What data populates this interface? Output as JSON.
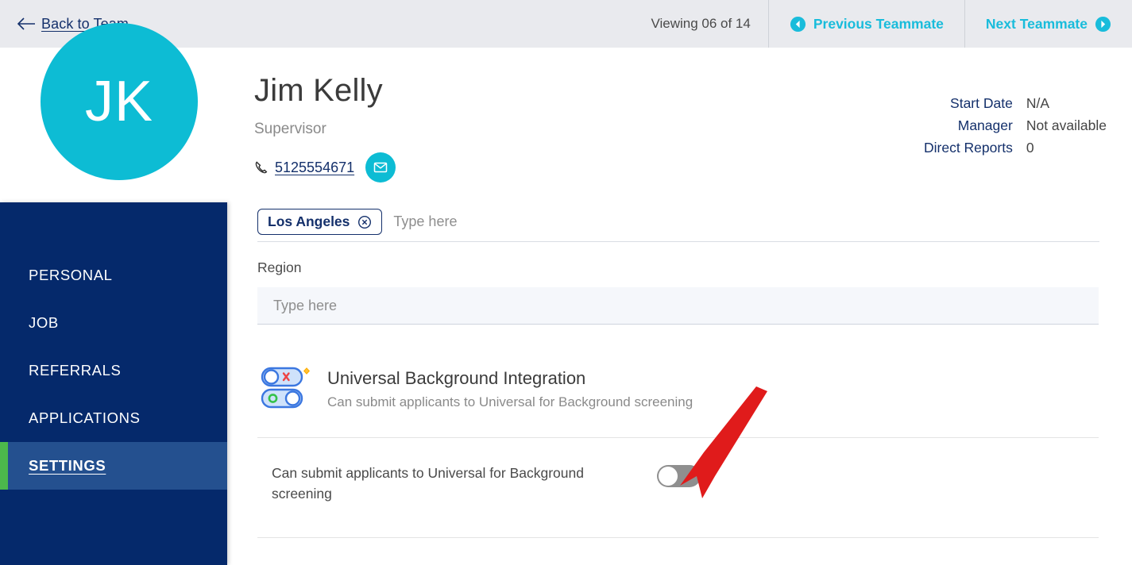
{
  "topbar": {
    "back_label": "Back to Team",
    "back_icon": "arrow-left-icon",
    "viewing_text": "Viewing 06 of 14",
    "previous_label": "Previous Teammate",
    "previous_icon": "chevron-left-circle-icon",
    "next_label": "Next Teammate",
    "next_icon": "chevron-right-circle-icon",
    "accent_color": "#19bcdb",
    "background_color": "#e9eaee"
  },
  "profile": {
    "avatar_initials": "JK",
    "avatar_color": "#0dbcd4",
    "name": "Jim Kelly",
    "job_title": "Supervisor",
    "phone": "5125554671",
    "phone_icon": "phone-icon",
    "email_icon": "envelope-icon",
    "meta": [
      {
        "label": "Start Date",
        "value": "N/A"
      },
      {
        "label": "Manager",
        "value": "Not available"
      },
      {
        "label": "Direct Reports",
        "value": "0"
      }
    ]
  },
  "sidebar": {
    "background_color": "#05296b",
    "active_color": "#24508f",
    "accent_color": "#4cb84c",
    "items": [
      {
        "label": "PERSONAL",
        "active": false
      },
      {
        "label": "JOB",
        "active": false
      },
      {
        "label": "REFERRALS",
        "active": false
      },
      {
        "label": "APPLICATIONS",
        "active": false
      },
      {
        "label": "SETTINGS",
        "active": true
      }
    ]
  },
  "content": {
    "location_field": {
      "chip_label": "Los Angeles",
      "chip_remove_icon": "close-circle-icon",
      "placeholder": "Type here"
    },
    "region_field": {
      "label": "Region",
      "placeholder": "Type here",
      "value": ""
    },
    "integration": {
      "icon": "toggles-integration-icon",
      "title": "Universal Background Integration",
      "subtitle": "Can submit applicants to Universal for Background screening"
    },
    "setting_toggle": {
      "label": "Can submit applicants to Universal for Background screening",
      "state": "off",
      "track_color": "#8f8f8f",
      "knob_color": "#ffffff"
    }
  },
  "annotation": {
    "arrow_color": "#e01b1b",
    "arrow_points_to": "setting-toggle-switch"
  }
}
